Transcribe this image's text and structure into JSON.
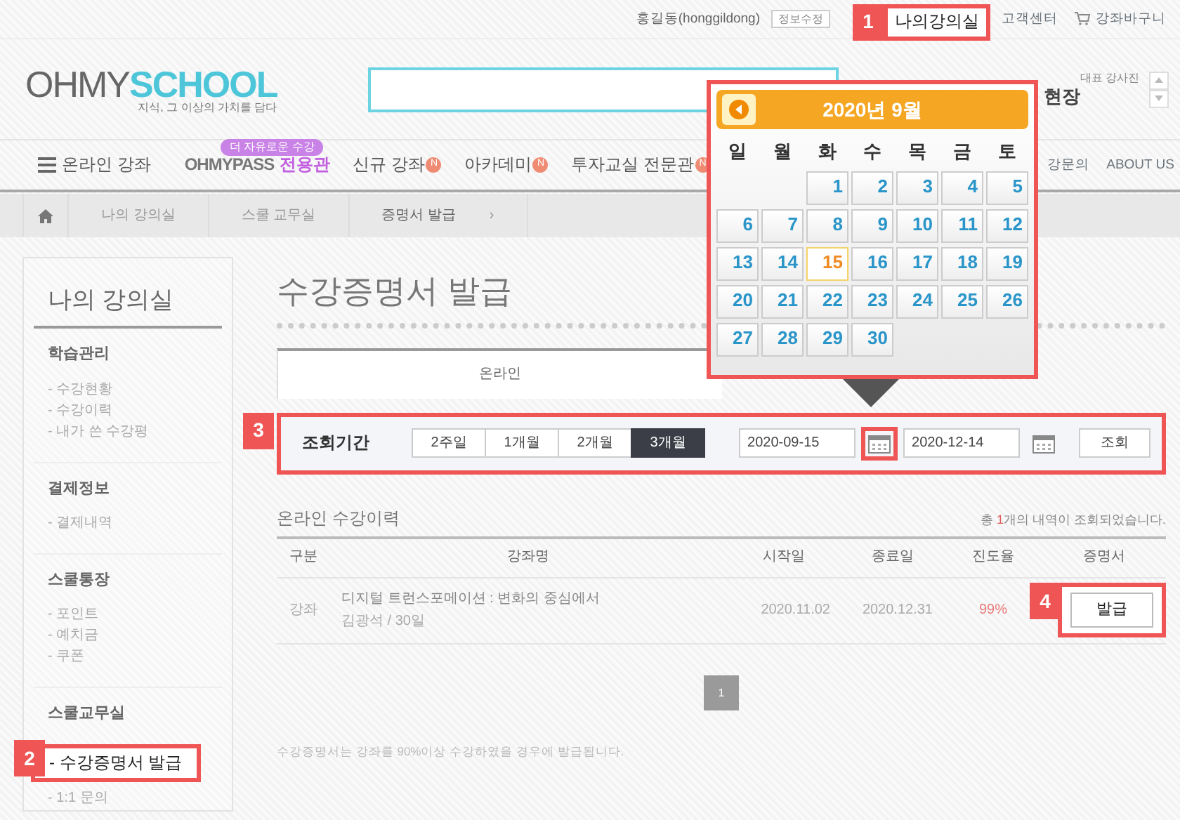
{
  "top_bar": {
    "user": "홍길동(honggildong)",
    "buttons": [
      "정보수정"
    ],
    "my_classroom": {
      "label": "나의강의실",
      "callout": "1"
    },
    "links": [
      "고객센터"
    ],
    "cart": "강좌바구니"
  },
  "header": {
    "logo": {
      "part_1": "OHMY",
      "part_2": "SCHOOL",
      "tagline": "지식, 그 이상의 가치를 담다"
    },
    "notice": {
      "caption": "대표 강사진",
      "headline": "현장"
    }
  },
  "nav": {
    "menu": "온라인 강좌",
    "pass": {
      "badge": "더 자유로운 수강",
      "brand": "OHMYPASS",
      "suffix": "전용관"
    },
    "items": [
      {
        "label": "신규 강좌",
        "badge": "N"
      },
      {
        "label": "아카데미",
        "badge": "N"
      },
      {
        "label": "투자교실 전문관",
        "badge": "N"
      }
    ],
    "right_items": [
      "강문의",
      "ABOUT US"
    ]
  },
  "breadcrumb": {
    "items": [
      "나의 강의실",
      "스쿨 교무실",
      "증명서 발급"
    ],
    "arrow": "›"
  },
  "sidebar": {
    "title": "나의 강의실",
    "groups": [
      {
        "title": "학습관리",
        "items": [
          {
            "label": "- 수강현황",
            "selected": false
          },
          {
            "label": "- 수강이력",
            "selected": false
          },
          {
            "label": "- 내가 쓴 수강평",
            "selected": false
          }
        ]
      },
      {
        "title": "결제정보",
        "items": [
          {
            "label": "- 결제내역",
            "selected": false
          }
        ]
      },
      {
        "title": "스쿨통장",
        "items": [
          {
            "label": "- 포인트",
            "selected": false
          },
          {
            "label": "- 예치금",
            "selected": false
          },
          {
            "label": "- 쿠폰",
            "selected": false
          }
        ]
      },
      {
        "title": "스쿨교무실",
        "items": [
          {
            "label": "- 수강증명서 발급",
            "selected": true,
            "callout": "2"
          },
          {
            "label": "- 1:1 문의",
            "selected": false
          }
        ]
      }
    ]
  },
  "main": {
    "title": "수강증명서 발급",
    "tabs": [
      {
        "label": "온라인",
        "selected": true
      }
    ],
    "filter": {
      "callout": "3",
      "label": "조회기간",
      "periods": [
        {
          "label": "2주일",
          "selected": false
        },
        {
          "label": "1개월",
          "selected": false
        },
        {
          "label": "2개월",
          "selected": false
        },
        {
          "label": "3개월",
          "selected": true
        }
      ],
      "dates": [
        {
          "value": "2020-09-15",
          "highlighted": true
        },
        {
          "value": "2020-12-14",
          "highlighted": false
        }
      ],
      "search_button": "조회"
    },
    "history": {
      "title": "온라인 수강이력",
      "summary": "총 **1**개의 내역이 조회되었습니다.",
      "columns": [
        "구분",
        "강좌명",
        "시작일",
        "종료일",
        "진도율",
        "증명서"
      ],
      "rows": [
        {
          "type": "강좌",
          "title": "디지털 트런스포메이션 : 변화의 중심에서",
          "meta": "김광석 / 30일",
          "start": "2020.11.02",
          "end": "2020.12.31",
          "progress": "99%",
          "action": "발급",
          "callout": "4"
        }
      ]
    },
    "pagination": [
      {
        "label": "1",
        "selected": true
      }
    ],
    "note": "수강증명서는 강좌를 90%이상 수강하였을 경우에 발급됩니다."
  },
  "calendar": {
    "title": "2020년 9월",
    "weekdays": [
      "일",
      "월",
      "화",
      "수",
      "목",
      "금",
      "토"
    ],
    "weeks": [
      [
        {
          "day": "1",
          "selected": false
        },
        {
          "day": "2",
          "selected": false
        },
        {
          "day": "3",
          "selected": false
        },
        {
          "day": "4",
          "selected": false
        },
        {
          "day": "5",
          "selected": false
        }
      ],
      [
        {
          "day": "6",
          "selected": false
        },
        {
          "day": "7",
          "selected": false
        },
        {
          "day": "8",
          "selected": false
        },
        {
          "day": "9",
          "selected": false
        },
        {
          "day": "10",
          "selected": false
        },
        {
          "day": "11",
          "selected": false
        },
        {
          "day": "12",
          "selected": false
        }
      ],
      [
        {
          "day": "13",
          "selected": false
        },
        {
          "day": "14",
          "selected": false
        },
        {
          "day": "15",
          "selected": true
        },
        {
          "day": "16",
          "selected": false
        },
        {
          "day": "17",
          "selected": false
        },
        {
          "day": "18",
          "selected": false
        },
        {
          "day": "19",
          "selected": false
        }
      ],
      [
        {
          "day": "20",
          "selected": false
        },
        {
          "day": "21",
          "selected": false
        },
        {
          "day": "22",
          "selected": false
        },
        {
          "day": "23",
          "selected": false
        },
        {
          "day": "24",
          "selected": false
        },
        {
          "day": "25",
          "selected": false
        },
        {
          "day": "26",
          "selected": false
        }
      ],
      [
        {
          "day": "27",
          "selected": false
        },
        {
          "day": "28",
          "selected": false
        },
        {
          "day": "29",
          "selected": false
        },
        {
          "day": "30",
          "selected": false
        }
      ]
    ]
  }
}
